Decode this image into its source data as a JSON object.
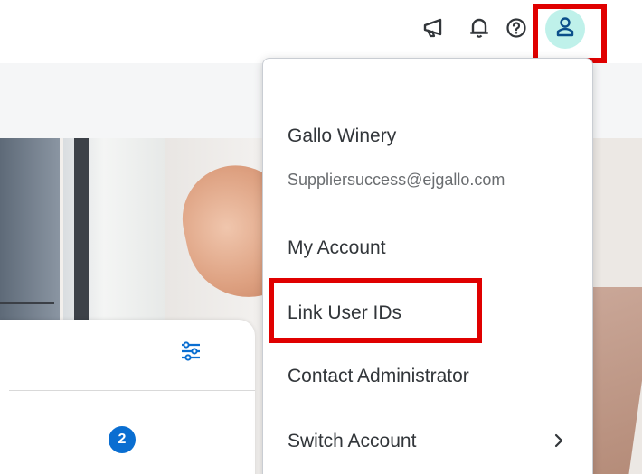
{
  "shellbar": {
    "icons": [
      "megaphone-icon",
      "bell-icon",
      "help-icon",
      "user-icon"
    ],
    "avatar_bg": "#bff1ea"
  },
  "user_menu": {
    "company_name": "Gallo Winery",
    "email": "Suppliersuccess@ejgallo.com",
    "items": [
      {
        "label": "My Account"
      },
      {
        "label": "Link User IDs"
      },
      {
        "label": "Contact Administrator"
      },
      {
        "label": "Switch Account"
      }
    ]
  },
  "card": {
    "badge_count": "2",
    "accent": "#0a6ed1"
  },
  "annotations": {
    "highlight_color": "#e00000"
  }
}
